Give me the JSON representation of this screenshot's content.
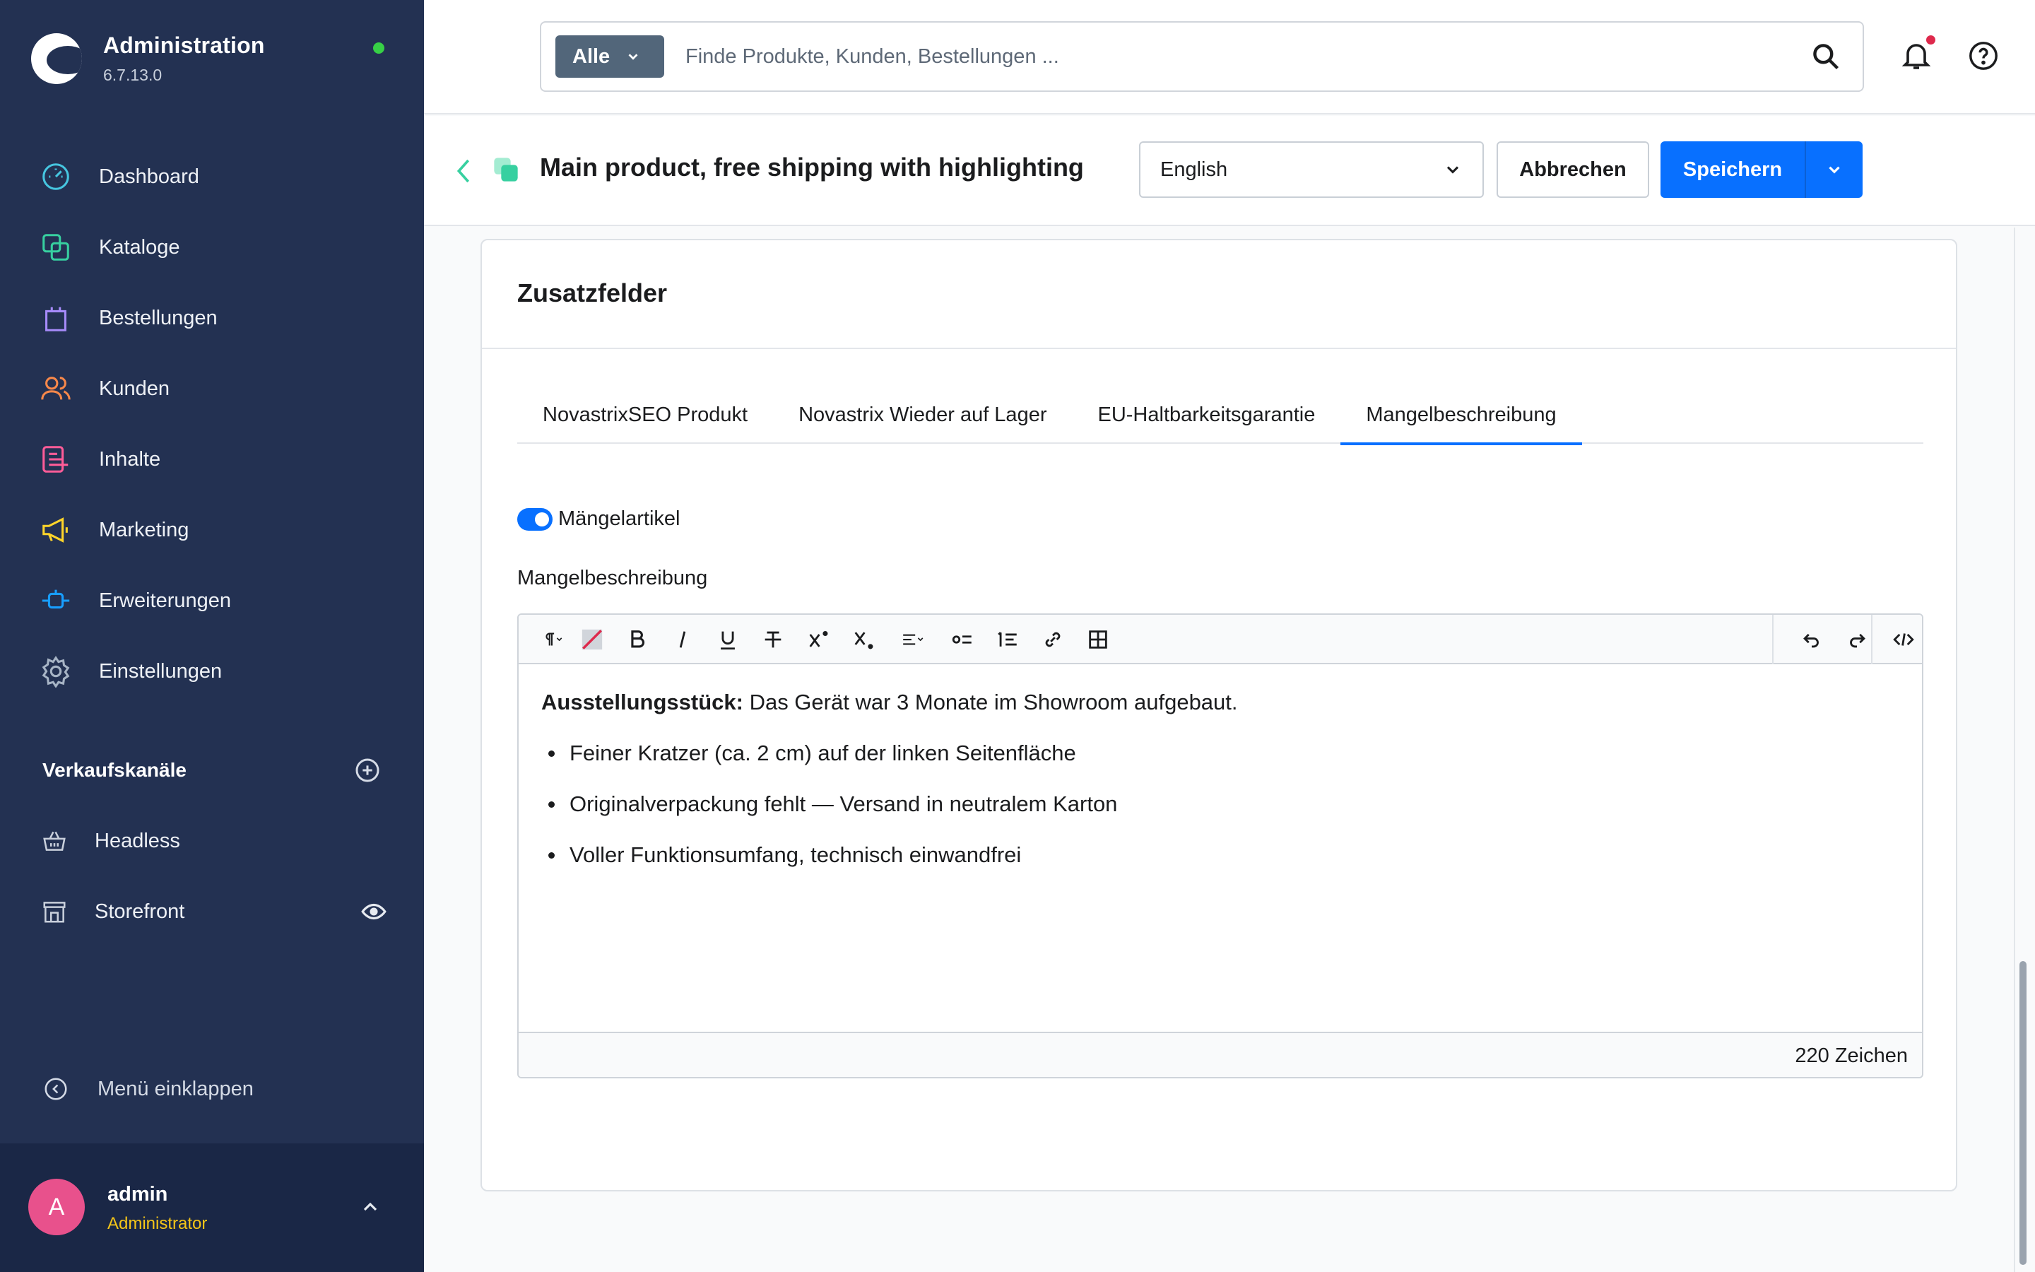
{
  "app": {
    "title": "Administration",
    "version": "6.7.13.0",
    "online_color": "#37d046",
    "sidebar_color": "#233152"
  },
  "nav": {
    "items": [
      {
        "label": "Dashboard",
        "icon": "gauge-icon",
        "color": "#46c6e0"
      },
      {
        "label": "Kataloge",
        "icon": "catalog-icon",
        "color": "#37d0a0"
      },
      {
        "label": "Bestellungen",
        "icon": "shopping-bag-icon",
        "color": "#a78bfa"
      },
      {
        "label": "Kunden",
        "icon": "users-icon",
        "color": "#f7884a"
      },
      {
        "label": "Inhalte",
        "icon": "content-icon",
        "color": "#ff5c98"
      },
      {
        "label": "Marketing",
        "icon": "megaphone-icon",
        "color": "#ffd52a"
      },
      {
        "label": "Erweiterungen",
        "icon": "plugin-icon",
        "color": "#189eff"
      },
      {
        "label": "Einstellungen",
        "icon": "gear-icon",
        "color": "#a7b4c5"
      }
    ]
  },
  "channels": {
    "title": "Verkaufskanäle",
    "items": [
      {
        "label": "Headless",
        "icon": "basket-icon"
      },
      {
        "label": "Storefront",
        "icon": "storefront-icon"
      }
    ]
  },
  "sidebar": {
    "collapse_label": "Menü einklappen"
  },
  "user": {
    "initial": "A",
    "name": "admin",
    "role": "Administrator"
  },
  "search": {
    "type_label": "Alle",
    "placeholder": "Finde Produkte, Kunden, Bestellungen ..."
  },
  "smartbar": {
    "title": "Main product, free shipping with highlighting",
    "language": "English",
    "cancel_label": "Abbrechen",
    "save_label": "Speichern",
    "accent_color": "#0870ff"
  },
  "card": {
    "title": "Zusatzfelder",
    "tabs": [
      {
        "label": "NovastrixSEO Produkt",
        "active": false
      },
      {
        "label": "Novastrix Wieder auf Lager",
        "active": false
      },
      {
        "label": "EU-Haltbarkeitsgarantie",
        "active": false
      },
      {
        "label": "Mangelbeschreibung",
        "active": true
      }
    ],
    "toggle_label": "Mängelartikel",
    "toggle_on": true,
    "field_label": "Mangelbeschreibung"
  },
  "editor": {
    "intro_bold": "Ausstellungsstück:",
    "intro_text": " Das Gerät war 3 Monate im Showroom aufgebaut.",
    "bullets": [
      "Feiner Kratzer (ca. 2 cm) auf der linken Seitenfläche",
      "Originalverpackung fehlt — Versand in neutralem Karton",
      "Voller Funktionsumfang, technisch einwandfrei"
    ],
    "char_count": "220 Zeichen"
  }
}
